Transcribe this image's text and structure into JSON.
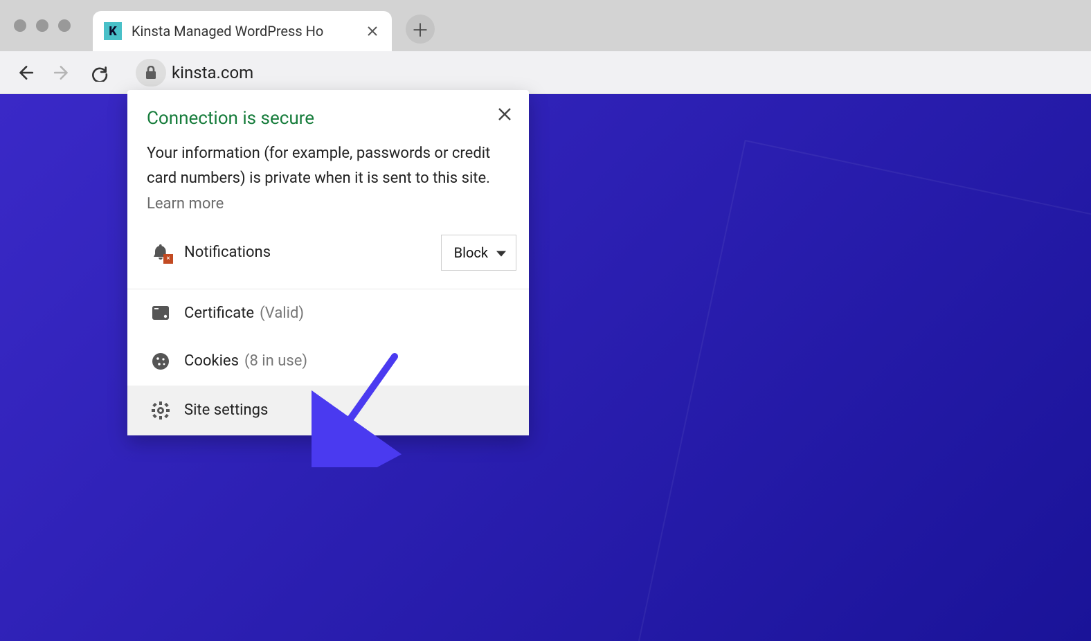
{
  "tab": {
    "title": "Kinsta Managed WordPress Ho",
    "favicon_letter": "K"
  },
  "address": {
    "host": "kinsta.com"
  },
  "popup": {
    "title": "Connection is secure",
    "description": "Your information (for example, passwords or credit card numbers) is private when it is sent to this site. ",
    "learn_more": "Learn more",
    "permission": {
      "label": "Notifications",
      "value": "Block"
    },
    "rows": {
      "certificate": {
        "label": "Certificate",
        "status": "(Valid)"
      },
      "cookies": {
        "label": "Cookies",
        "status": "(8 in use)"
      },
      "site_settings": {
        "label": "Site settings"
      }
    }
  }
}
